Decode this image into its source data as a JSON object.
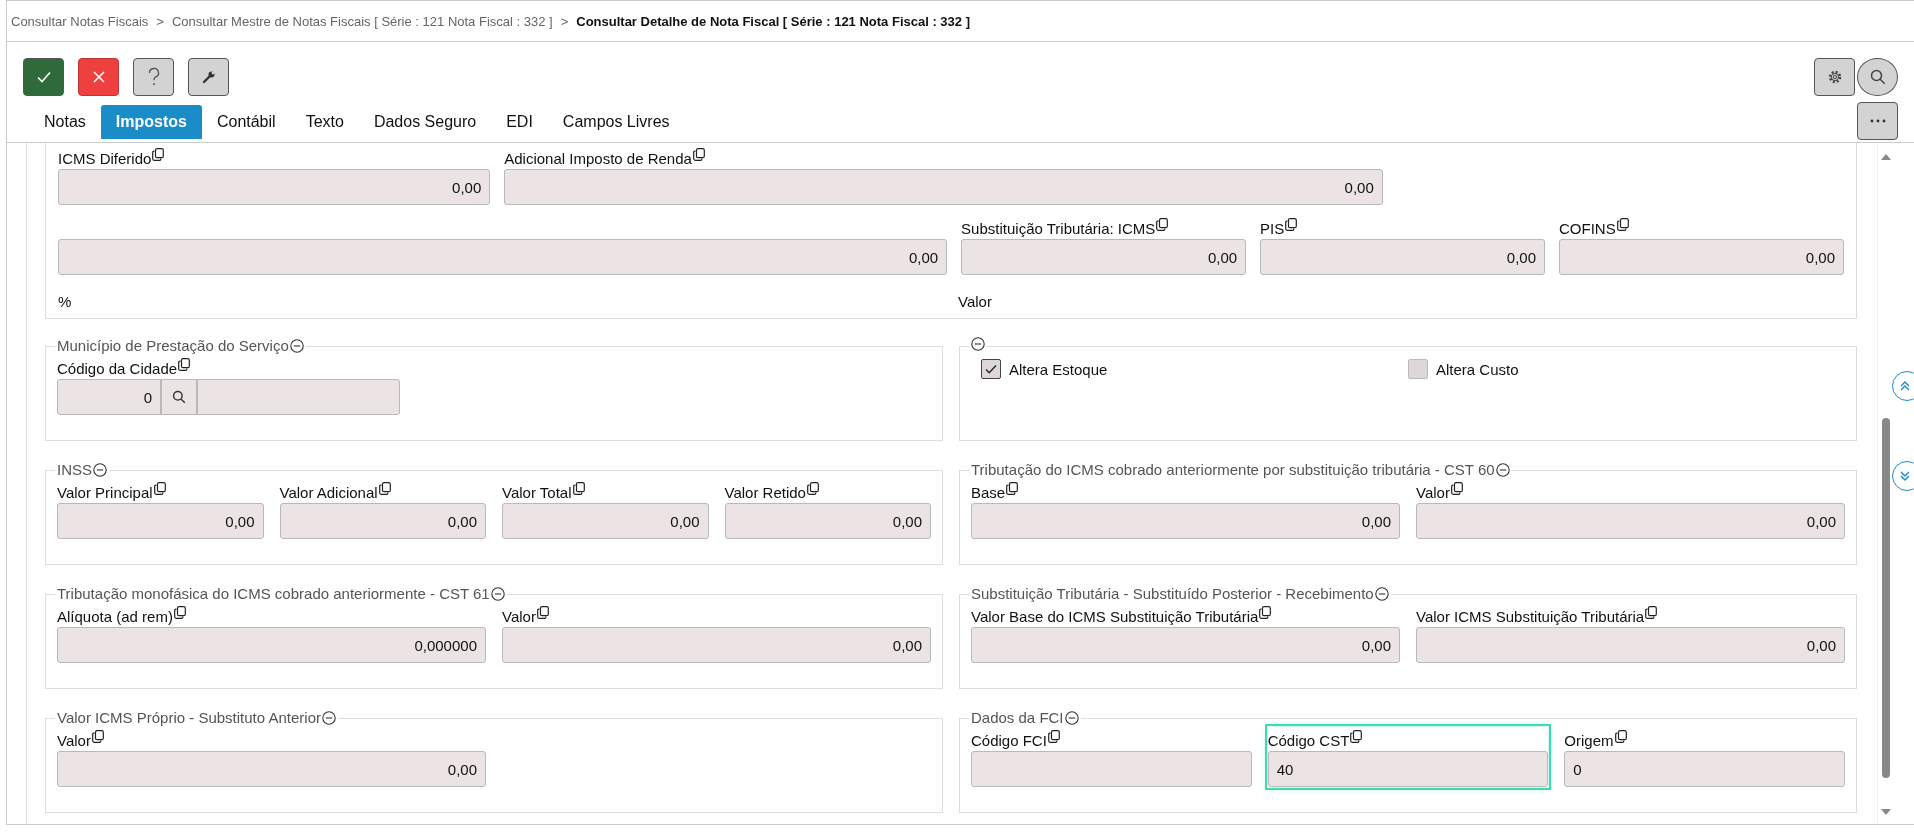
{
  "breadcrumb": [
    {
      "kind": "link",
      "text": "Consultar Notas Fiscais"
    },
    {
      "kind": "separator",
      "text": ">"
    },
    {
      "kind": "link",
      "text": "Consultar Mestre de Notas Fiscais [ Série : 121 Nota Fiscal : 332 ]"
    },
    {
      "kind": "separator",
      "text": ">"
    },
    {
      "kind": "current",
      "text": "Consultar Detalhe de Nota Fiscal [ Série : 121 Nota Fiscal : 332 ]"
    }
  ],
  "toolbar": [
    {
      "kind": "confirm"
    },
    {
      "kind": "cancel"
    },
    {
      "kind": "help"
    },
    {
      "kind": "tools"
    }
  ],
  "tabs": [
    {
      "label": "Notas",
      "selected": false
    },
    {
      "label": "Impostos",
      "selected": true
    },
    {
      "label": "Contábil",
      "selected": false
    },
    {
      "label": "Texto",
      "selected": false
    },
    {
      "label": "Dados Seguro",
      "selected": false
    },
    {
      "label": "EDI",
      "selected": false
    },
    {
      "label": "Campos Livres",
      "selected": false
    }
  ],
  "top_panel": {
    "rows": [
      {
        "fields": [
          {
            "label": "ICMS Diferido",
            "value": "0,00",
            "kind": "number"
          },
          {
            "label": "Adicional Imposto de Renda",
            "value": "0,00",
            "kind": "number"
          }
        ]
      },
      {
        "fields": [
          {
            "value": "0,00",
            "kind": "number"
          },
          {
            "label": "Substituição Tributária: ICMS",
            "value": "0,00",
            "kind": "number"
          },
          {
            "label": "PIS",
            "value": "0,00",
            "kind": "number"
          },
          {
            "label": "COFINS",
            "value": "0,00",
            "kind": "number"
          }
        ]
      }
    ],
    "captions": [
      "%",
      "Valor"
    ]
  },
  "panels": [
    {
      "kind": "fields",
      "title": "Município de Prestação do Serviço",
      "fields": [
        {
          "label": "Código da Cidade",
          "value": "0",
          "kind": "lookup"
        }
      ]
    },
    {
      "kind": "checkboxes",
      "checkboxes": [
        {
          "label": "Altera Estoque",
          "checked": true
        },
        {
          "label": "Altera Custo",
          "checked": false
        }
      ]
    },
    {
      "kind": "fields",
      "title": "INSS",
      "fields": [
        {
          "label": "Valor Principal",
          "value": "0,00",
          "kind": "number"
        },
        {
          "label": "Valor Adicional",
          "value": "0,00",
          "kind": "number"
        },
        {
          "label": "Valor Total",
          "value": "0,00",
          "kind": "number"
        },
        {
          "label": "Valor Retido",
          "value": "0,00",
          "kind": "number"
        }
      ]
    },
    {
      "kind": "fields",
      "title": "Tributação do ICMS cobrado anteriormente por substituição tributária - CST 60",
      "fields": [
        {
          "label": "Base",
          "value": "0,00",
          "kind": "number"
        },
        {
          "label": "Valor",
          "value": "0,00",
          "kind": "number"
        }
      ]
    },
    {
      "kind": "fields",
      "title": "Tributação monofásica do ICMS cobrado anteriormente - CST 61",
      "fields": [
        {
          "label": "Alíquota (ad rem)",
          "value": "0,000000",
          "kind": "number"
        },
        {
          "label": "Valor",
          "value": "0,00",
          "kind": "number"
        }
      ]
    },
    {
      "kind": "fields",
      "title": "Substituição Tributária - Substituído Posterior - Recebimento",
      "fields": [
        {
          "label": "Valor Base do ICMS Substituição Tributária",
          "value": "0,00",
          "kind": "number"
        },
        {
          "label": "Valor ICMS Substituição Tributária",
          "value": "0,00",
          "kind": "number"
        }
      ]
    },
    {
      "kind": "fields",
      "title": "Valor ICMS Próprio - Substituto Anterior",
      "fields": [
        {
          "label": "Valor",
          "value": "0,00",
          "kind": "number"
        }
      ]
    },
    {
      "kind": "fields",
      "title": "Dados da FCI",
      "fields": [
        {
          "label": "Código FCI",
          "kind": "text",
          "focused": false
        },
        {
          "label": "Código CST",
          "value": "40",
          "kind": "text",
          "focused": true
        },
        {
          "label": "Origem",
          "value": "0",
          "kind": "text",
          "focused": false
        }
      ]
    }
  ]
}
